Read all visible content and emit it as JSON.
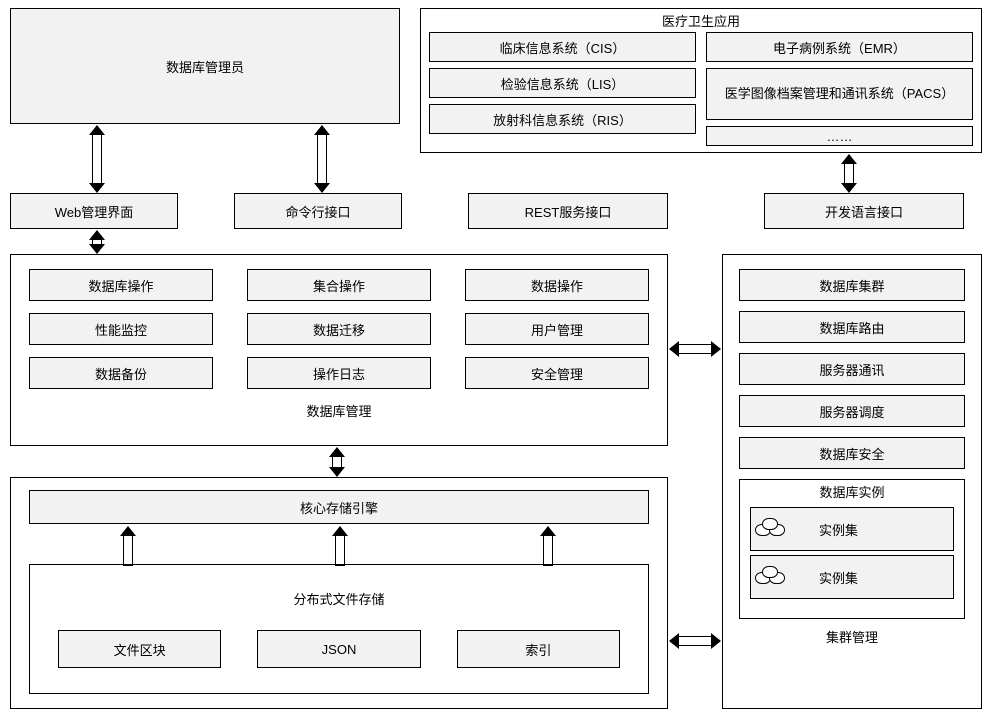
{
  "topLeft": {
    "dba": "数据库管理员"
  },
  "topRight": {
    "title": "医疗卫生应用",
    "left": [
      "临床信息系统（CIS）",
      "检验信息系统（LIS）",
      "放射科信息系统（RIS）"
    ],
    "right": [
      "电子病例系统（EMR）",
      "医学图像档案管理和通讯系统（PACS）",
      "……"
    ]
  },
  "interfaces": {
    "web": "Web管理界面",
    "cli": "命令行接口",
    "rest": "REST服务接口",
    "sdk": "开发语言接口"
  },
  "dbmgmt": {
    "title": "数据库管理",
    "col1": [
      "数据库操作",
      "性能监控",
      "数据备份"
    ],
    "col2": [
      "集合操作",
      "数据迁移",
      "操作日志"
    ],
    "col3": [
      "数据操作",
      "用户管理",
      "安全管理"
    ]
  },
  "engine": {
    "core": "核心存储引擎"
  },
  "dfs": {
    "title": "分布式文件存储",
    "items": [
      "文件区块",
      "JSON",
      "索引"
    ]
  },
  "cluster": {
    "title": "集群管理",
    "items": [
      "数据库集群",
      "数据库路由",
      "服务器通讯",
      "服务器调度",
      "数据库安全"
    ],
    "instanceTitle": "数据库实例",
    "instanceSet": "实例集"
  }
}
